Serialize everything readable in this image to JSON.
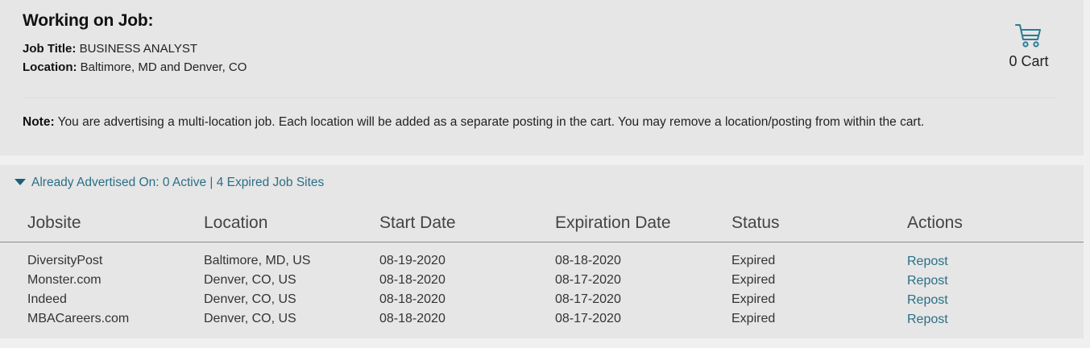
{
  "job": {
    "heading": "Working on Job:",
    "title_label": "Job Title:",
    "title_value": "BUSINESS ANALYST",
    "location_label": "Location:",
    "location_value": "Baltimore, MD and Denver, CO"
  },
  "cart": {
    "icon": "cart-icon",
    "label": "0 Cart"
  },
  "note": {
    "label": "Note:",
    "text": "You are advertising a multi-location job. Each location will be added as a separate posting in the cart. You may remove a location/posting from within the cart."
  },
  "advertised": {
    "toggle_label": "Already Advertised On: 0 Active | 4 Expired Job Sites",
    "columns": [
      "Jobsite",
      "Location",
      "Start Date",
      "Expiration Date",
      "Status",
      "Actions"
    ],
    "rows": [
      {
        "jobsite": "DiversityPost",
        "location": "Baltimore, MD, US",
        "start": "08-19-2020",
        "expiration": "08-18-2020",
        "status": "Expired",
        "action": "Repost"
      },
      {
        "jobsite": "Monster.com",
        "location": "Denver, CO, US",
        "start": "08-18-2020",
        "expiration": "08-17-2020",
        "status": "Expired",
        "action": "Repost"
      },
      {
        "jobsite": "Indeed",
        "location": "Denver, CO, US",
        "start": "08-18-2020",
        "expiration": "08-17-2020",
        "status": "Expired",
        "action": "Repost"
      },
      {
        "jobsite": "MBACareers.com",
        "location": "Denver, CO, US",
        "start": "08-18-2020",
        "expiration": "08-17-2020",
        "status": "Expired",
        "action": "Repost"
      }
    ]
  },
  "colors": {
    "link": "#2a6f86",
    "panel_bg": "#e6e6e6",
    "page_bg": "#f0f0f0"
  }
}
